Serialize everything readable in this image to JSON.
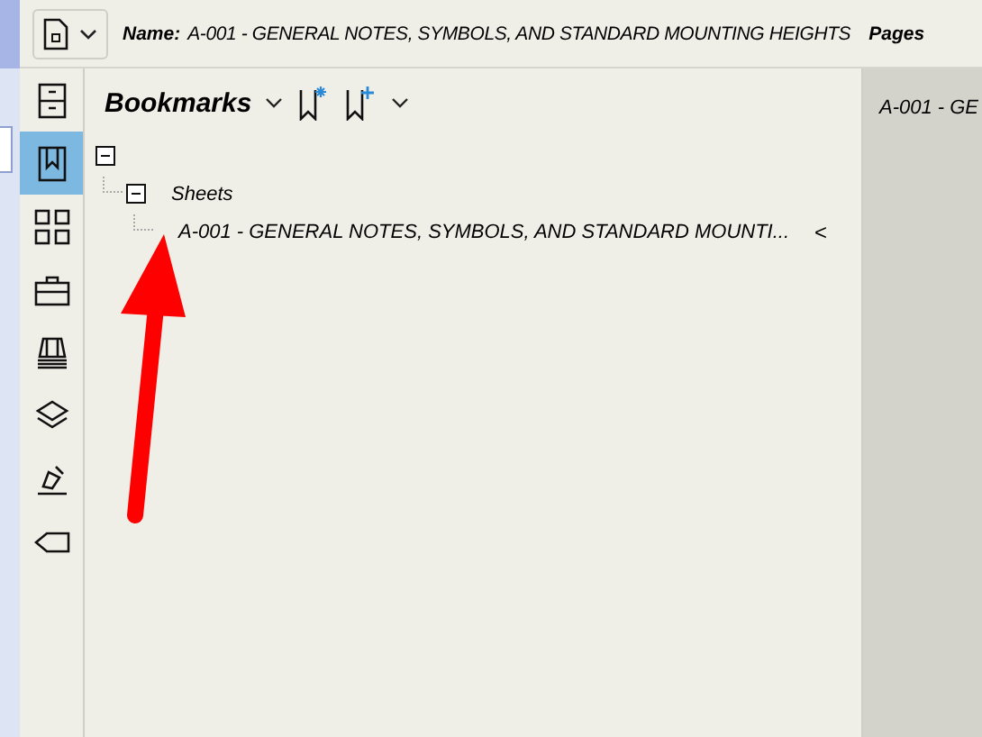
{
  "toolbar": {
    "name_label": "Name:",
    "name_value": "A-001 - GENERAL NOTES, SYMBOLS, AND STANDARD MOUNTING HEIGHTS",
    "pages_label": "Pages"
  },
  "sidebar": {
    "items": [
      {
        "kind": "cabinet",
        "selected": false
      },
      {
        "kind": "bookmark",
        "selected": true
      },
      {
        "kind": "grid",
        "selected": false
      },
      {
        "kind": "toolbox",
        "selected": false
      },
      {
        "kind": "stack",
        "selected": false
      },
      {
        "kind": "layers",
        "selected": false
      },
      {
        "kind": "pen",
        "selected": false
      },
      {
        "kind": "tag",
        "selected": false
      }
    ]
  },
  "panel": {
    "title": "Bookmarks"
  },
  "tree": [
    {
      "expanded": true,
      "children": [
        {
          "label": "Sheets",
          "expanded": true,
          "children": [
            {
              "label": "A-001 - GENERAL NOTES, SYMBOLS, AND STANDARD MOUNTI...",
              "arrow": "<"
            }
          ]
        }
      ]
    }
  ],
  "page_view": {
    "title": "A-001 - GE"
  }
}
